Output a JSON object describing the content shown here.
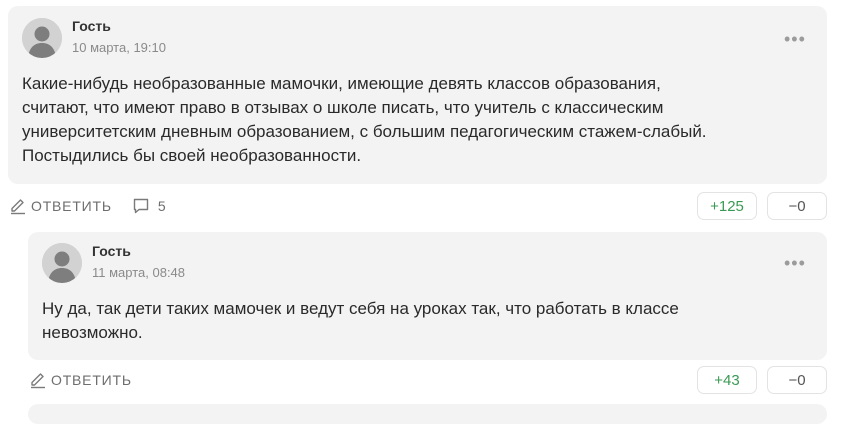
{
  "comments": [
    {
      "author": "Гость",
      "date": "10 марта, 19:10",
      "more": "•••",
      "text_lines": [
        "Какие-нибудь необразованные мамочки, имеющие девять классов образования,",
        "считают, что имеют право в отзывах о школе писать, что учитель с классическим",
        "университетским дневным образованием, с большим педагогическим стажем-слабый.",
        "Постыдились бы своей необразованности."
      ],
      "reply_label": "ОТВЕТИТЬ",
      "replies_count": "5",
      "upvotes": "+125",
      "downvotes": "−0"
    },
    {
      "author": "Гость",
      "date": "11 марта, 08:48",
      "more": "•••",
      "text_lines": [
        "Ну да, так дети таких мамочек и ведут себя на уроках так, что работать в классе",
        "невозможно."
      ],
      "reply_label": "ОТВЕТИТЬ",
      "upvotes": "+43",
      "downvotes": "−0"
    }
  ],
  "icons": {
    "avatar": "user-avatar-icon",
    "reply": "pencil-icon",
    "replies": "speech-bubble-icon",
    "more": "ellipsis-icon"
  },
  "colors": {
    "card_bg": "#f3f3f3",
    "upvote": "#3a9a55",
    "muted": "#8a8a8a"
  }
}
